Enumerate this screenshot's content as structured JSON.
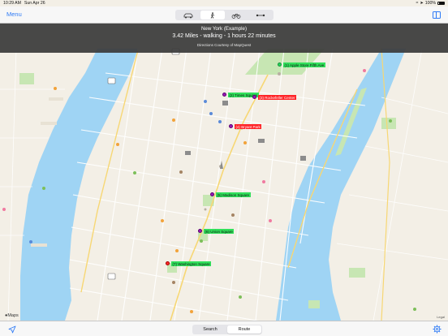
{
  "status_bar": {
    "time": "10:29 AM",
    "date": "Sun Apr 26",
    "battery": "100%"
  },
  "nav": {
    "menu_label": "Menu",
    "modes": [
      {
        "name": "car-icon",
        "active": false
      },
      {
        "name": "walking-icon",
        "active": true
      },
      {
        "name": "bicycle-icon",
        "active": false
      },
      {
        "name": "route-line-icon",
        "active": false
      }
    ]
  },
  "banner": {
    "city": "New York (Example)",
    "summary": "3.42 Miles - walking - 1 hours 22 minutes",
    "credit": "Directions Courtesy of MapQuest"
  },
  "stops": [
    {
      "label": "(1) Apple Store Fifth Ave",
      "color": "green"
    },
    {
      "label": "(2) Times Square",
      "color": "green"
    },
    {
      "label": "(3) Rockefeller Center",
      "color": "red"
    },
    {
      "label": "(4) Bryant Park",
      "color": "red"
    },
    {
      "label": "(5) Madison Square",
      "color": "green"
    },
    {
      "label": "(6) Union Square",
      "color": "green"
    },
    {
      "label": "(7) Washington Square",
      "color": "green"
    }
  ],
  "map": {
    "attribution": "Maps",
    "legal": "Legal",
    "highway_shield": "495",
    "highway_shield_2": "9A"
  },
  "toolbar": {
    "search_label": "Search",
    "route_label": "Route",
    "active": "Route"
  },
  "colors": {
    "accent": "#2f7bf6",
    "water": "#9fd4f4",
    "park": "#c7e6b3",
    "label_green": "#31e05b",
    "label_red": "#ff2226",
    "pin_purple": "#9a16b8"
  }
}
